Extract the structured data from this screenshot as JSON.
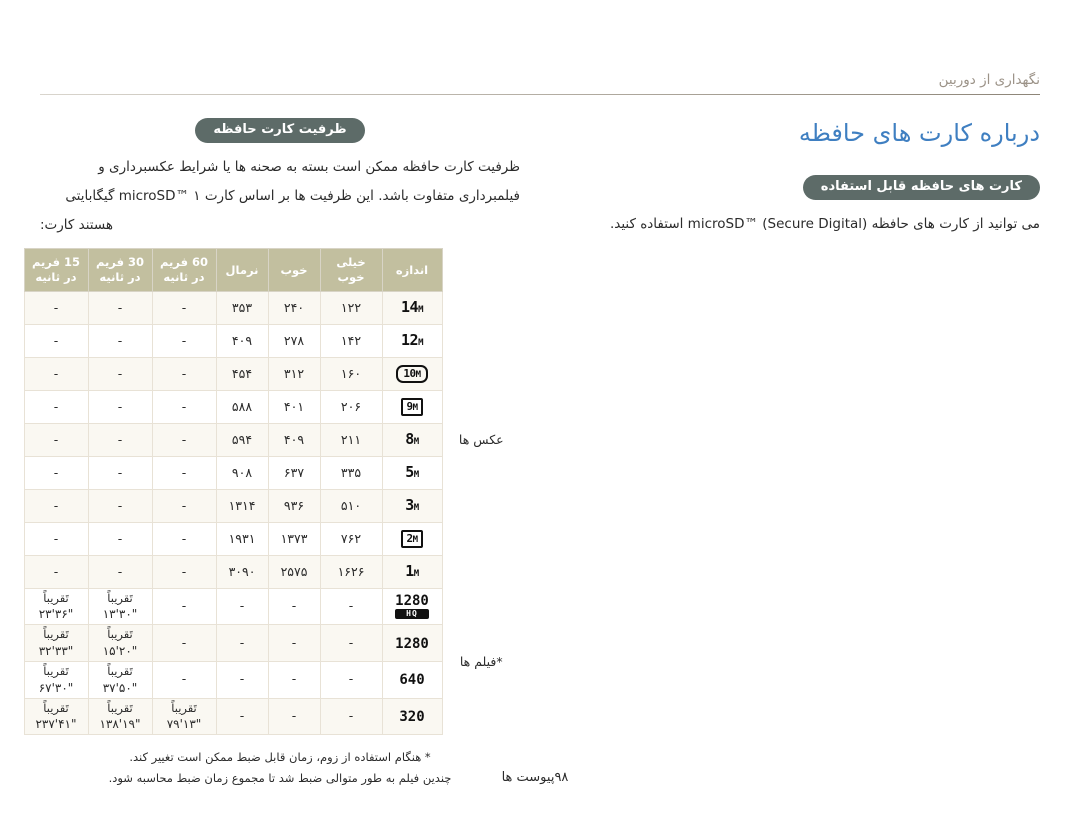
{
  "running_head": "نگهداری از دوربین",
  "page_footer": {
    "label": "پیوست ها",
    "number": "۹۸"
  },
  "colors": {
    "badge_bg": "#5d6b68",
    "heading": "#3f7fc1",
    "table_header_bg": "#c2bf9f",
    "rule": "#8d8578"
  },
  "right_column": {
    "heading": "درباره کارت های حافظه",
    "badge": "کارت های حافظه قابل استفاده",
    "paragraph": "می توانید از کارت های حافظه microSD™ (Secure Digital) استفاده کنید."
  },
  "left_column": {
    "badge": "ظرفیت کارت حافظه",
    "paragraph_line1": "ظرفیت کارت حافظه ممکن است بسته به صحنه ها یا شرایط عکسبرداری و",
    "paragraph_line2": "فیلمبرداری متفاوت باشد. این ظرفیت ها بر اساس کارت microSD™ ۱ گیگابایتی",
    "paragraph_line3": "هستند کارت:",
    "footnotes": [
      "* هنگام استفاده از زوم، زمان قابل ضبط ممکن است تغییر کند.",
      "چندین فیلم به طور متوالی ضبط شد تا مجموع زمان ضبط محاسبه شود."
    ]
  },
  "table": {
    "headers": {
      "size": "اندازه",
      "super_fine": "خیلی خوب",
      "fine": "خوب",
      "normal": "نرمال",
      "fps60": "60 فریم در ثانیه",
      "fps30": "30 فریم در ثانیه",
      "fps15": "15 فریم در ثانیه"
    },
    "group_labels": {
      "photos": "عکس ها",
      "videos": "*فیلم ها"
    },
    "photo_rows": [
      {
        "size": "14",
        "unit": "M",
        "style": "plain",
        "super_fine": "۱۲۲",
        "fine": "۲۴۰",
        "normal": "۳۵۳",
        "fps60": "-",
        "fps30": "-",
        "fps15": "-"
      },
      {
        "size": "12",
        "unit": "M",
        "style": "plain",
        "super_fine": "۱۴۲",
        "fine": "۲۷۸",
        "normal": "۴۰۹",
        "fps60": "-",
        "fps30": "-",
        "fps15": "-"
      },
      {
        "size": "10",
        "unit": "M",
        "style": "round",
        "super_fine": "۱۶۰",
        "fine": "۳۱۲",
        "normal": "۴۵۴",
        "fps60": "-",
        "fps30": "-",
        "fps15": "-"
      },
      {
        "size": "9",
        "unit": "M",
        "style": "boxed",
        "super_fine": "۲۰۶",
        "fine": "۴۰۱",
        "normal": "۵۸۸",
        "fps60": "-",
        "fps30": "-",
        "fps15": "-"
      },
      {
        "size": "8",
        "unit": "M",
        "style": "plain",
        "super_fine": "۲۱۱",
        "fine": "۴۰۹",
        "normal": "۵۹۴",
        "fps60": "-",
        "fps30": "-",
        "fps15": "-"
      },
      {
        "size": "5",
        "unit": "M",
        "style": "plain",
        "super_fine": "۳۳۵",
        "fine": "۶۳۷",
        "normal": "۹۰۸",
        "fps60": "-",
        "fps30": "-",
        "fps15": "-"
      },
      {
        "size": "3",
        "unit": "M",
        "style": "plain",
        "super_fine": "۵۱۰",
        "fine": "۹۳۶",
        "normal": "۱۳۱۴",
        "fps60": "-",
        "fps30": "-",
        "fps15": "-"
      },
      {
        "size": "2",
        "unit": "M",
        "style": "boxed",
        "super_fine": "۷۶۲",
        "fine": "۱۳۷۳",
        "normal": "۱۹۳۱",
        "fps60": "-",
        "fps30": "-",
        "fps15": "-"
      },
      {
        "size": "1",
        "unit": "M",
        "style": "plain",
        "super_fine": "۱۶۲۶",
        "fine": "۲۵۷۵",
        "normal": "۳۰۹۰",
        "fps60": "-",
        "fps30": "-",
        "fps15": "-"
      }
    ],
    "video_rows": [
      {
        "size": "1280",
        "style": "hq",
        "hq_label": "HQ",
        "super_fine": "-",
        "fine": "-",
        "normal": "-",
        "fps60": "-",
        "fps30_approx": "تَقریباً",
        "fps30": "۱۳'۳۰\"",
        "fps15_approx": "تَقریباً",
        "fps15": "۲۳'۳۶\""
      },
      {
        "size": "1280",
        "style": "vid",
        "super_fine": "-",
        "fine": "-",
        "normal": "-",
        "fps60": "-",
        "fps30_approx": "تَقریباً",
        "fps30": "۱۵'۲۰\"",
        "fps15_approx": "تَقریباً",
        "fps15": "۳۲'۳۳\""
      },
      {
        "size": "640",
        "style": "vid",
        "super_fine": "-",
        "fine": "-",
        "normal": "-",
        "fps60": "-",
        "fps30_approx": "تَقریباً",
        "fps30": "۳۷'۵۰\"",
        "fps15_approx": "تَقریباً",
        "fps15": "۶۷'۳۰\""
      },
      {
        "size": "320",
        "style": "vid",
        "super_fine": "-",
        "fine": "-",
        "normal": "-",
        "fps60_approx": "تَقریباً",
        "fps60": "۷۹'۱۳\"",
        "fps30_approx": "تَقریباً",
        "fps30": "۱۳۸'۱۹\"",
        "fps15_approx": "تَقریباً",
        "fps15": "۲۳۷'۴۱\""
      }
    ]
  }
}
